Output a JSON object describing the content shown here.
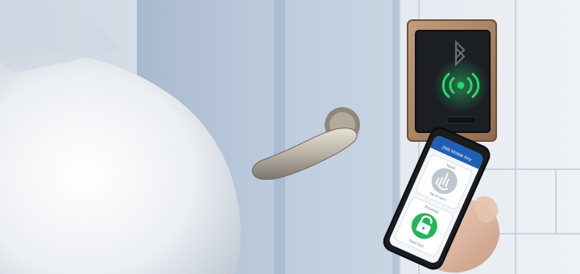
{
  "colors": {
    "wall": "#d9dfe8",
    "door": "#b9c9db",
    "door_shadow": "#9fb1c6",
    "reader_frame": "#b08a6a",
    "reader_panel": "#1b1f24",
    "reader_glow": "#27d86a",
    "phone_body": "#1a1c20",
    "app_header": "#1e5fb6",
    "app_bg": "#f3f6fa",
    "app_card": "#ffffff",
    "button_grey": "#bfc6cf",
    "button_green": "#24b45a"
  },
  "icons": {
    "reader_top": "bluetooth-icon",
    "reader_signal": "nfc-signal-icon",
    "app_touch": "hand-tap-icon",
    "app_unlock": "padlock-open-icon"
  },
  "app": {
    "title": "2N® Mobile Key",
    "card1_title": "Touch",
    "card1_caption": "Tap to open",
    "card2_title": "Proximity",
    "card2_caption": "Open door"
  }
}
